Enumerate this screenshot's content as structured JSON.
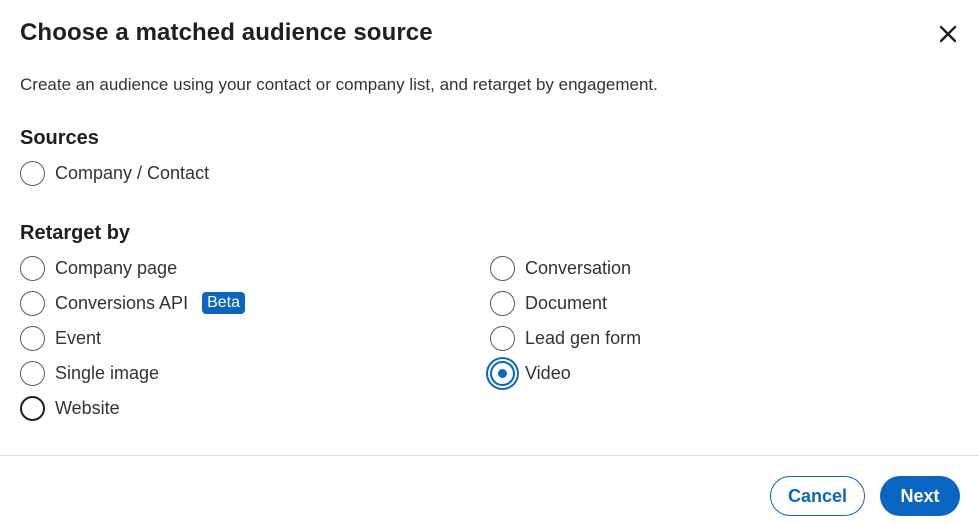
{
  "dialog": {
    "title": "Choose a matched audience source",
    "subtitle": "Create an audience using your contact or company list, and retarget by engagement.",
    "close_icon": "close-icon"
  },
  "sources": {
    "heading": "Sources",
    "options": [
      {
        "label": "Company / Contact",
        "selected": false
      }
    ]
  },
  "retarget": {
    "heading": "Retarget by",
    "left_options": [
      {
        "label": "Company page",
        "selected": false
      },
      {
        "label": "Conversions API",
        "badge": "Beta",
        "selected": false
      },
      {
        "label": "Event",
        "selected": false
      },
      {
        "label": "Single image",
        "selected": false
      },
      {
        "label": "Website",
        "selected": false
      }
    ],
    "right_options": [
      {
        "label": "Conversation",
        "selected": false
      },
      {
        "label": "Document",
        "selected": false
      },
      {
        "label": "Lead gen form",
        "selected": false
      },
      {
        "label": "Video",
        "selected": true
      }
    ]
  },
  "footer": {
    "cancel_label": "Cancel",
    "next_label": "Next"
  },
  "colors": {
    "accent": "#0a66c2",
    "text": "#1f1f1f"
  }
}
